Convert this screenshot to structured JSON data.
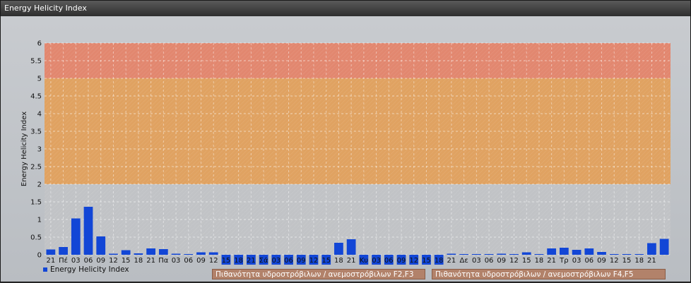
{
  "window": {
    "title": "Energy Helicity Index"
  },
  "legend": {
    "label": "Energy Helicity Index"
  },
  "buttons": {
    "f2f3": "Πιθανότητα υδροστρόβιλων / ανεμοστρόβιλων F2,F3",
    "f4f5": "Πιθανότητα υδροστρόβιλων / ανεμοστρόβιλων F4,F5"
  },
  "colors": {
    "bar": "#1246d6",
    "zone_low": "#c1c3c6",
    "zone_mid": "#e0a261",
    "zone_high": "#e2876f"
  },
  "chart_data": {
    "type": "bar",
    "title": "",
    "xlabel": "",
    "ylabel": "Energy Helicity Index",
    "ylim": [
      0,
      6
    ],
    "yticks": [
      "0",
      "0.5",
      "1",
      "1.5",
      "2",
      "2.5",
      "3",
      "3.5",
      "4",
      "4.5",
      "5",
      "5.5",
      "6"
    ],
    "grid": true,
    "legend_position": "bottom-left",
    "zones": [
      {
        "from": 0,
        "to": 2,
        "color": "#c1c3c6"
      },
      {
        "from": 2,
        "to": 5,
        "color": "#e0a261"
      },
      {
        "from": 5,
        "to": 6,
        "color": "#e2876f"
      }
    ],
    "categories": [
      "21",
      "Πέ",
      "03",
      "06",
      "09",
      "12",
      "15",
      "18",
      "21",
      "Πα",
      "03",
      "06",
      "09",
      "12",
      "15",
      "18",
      "21",
      "Σά",
      "03",
      "06",
      "09",
      "12",
      "15",
      "18",
      "21",
      "Κυ",
      "03",
      "06",
      "09",
      "12",
      "15",
      "18",
      "21",
      "Δε",
      "03",
      "06",
      "09",
      "12",
      "15",
      "18",
      "21",
      "Τρ",
      "03",
      "06",
      "09",
      "12",
      "15",
      "18",
      "21"
    ],
    "series": [
      {
        "name": "Energy Helicity Index",
        "values": [
          0.15,
          0.22,
          1.03,
          1.36,
          0.52,
          0.03,
          0.13,
          0.04,
          0.18,
          0.16,
          0.03,
          0.02,
          0.07,
          0.07,
          0.0,
          0.0,
          0.0,
          0.0,
          0.0,
          0.0,
          0.0,
          0.0,
          0.0,
          0.34,
          0.44,
          0.0,
          0.02,
          0.02,
          0.02,
          0.02,
          0.02,
          0.03,
          0.03,
          0.02,
          0.02,
          0.02,
          0.03,
          0.02,
          0.07,
          0.02,
          0.18,
          0.2,
          0.14,
          0.18,
          0.08,
          0.02,
          0.02,
          0.02,
          0.33,
          0.45
        ]
      }
    ],
    "below_zero_marks": [
      14,
      15,
      16,
      17,
      18,
      19,
      20,
      21,
      22,
      25,
      26,
      27,
      28,
      29,
      30,
      31
    ]
  }
}
